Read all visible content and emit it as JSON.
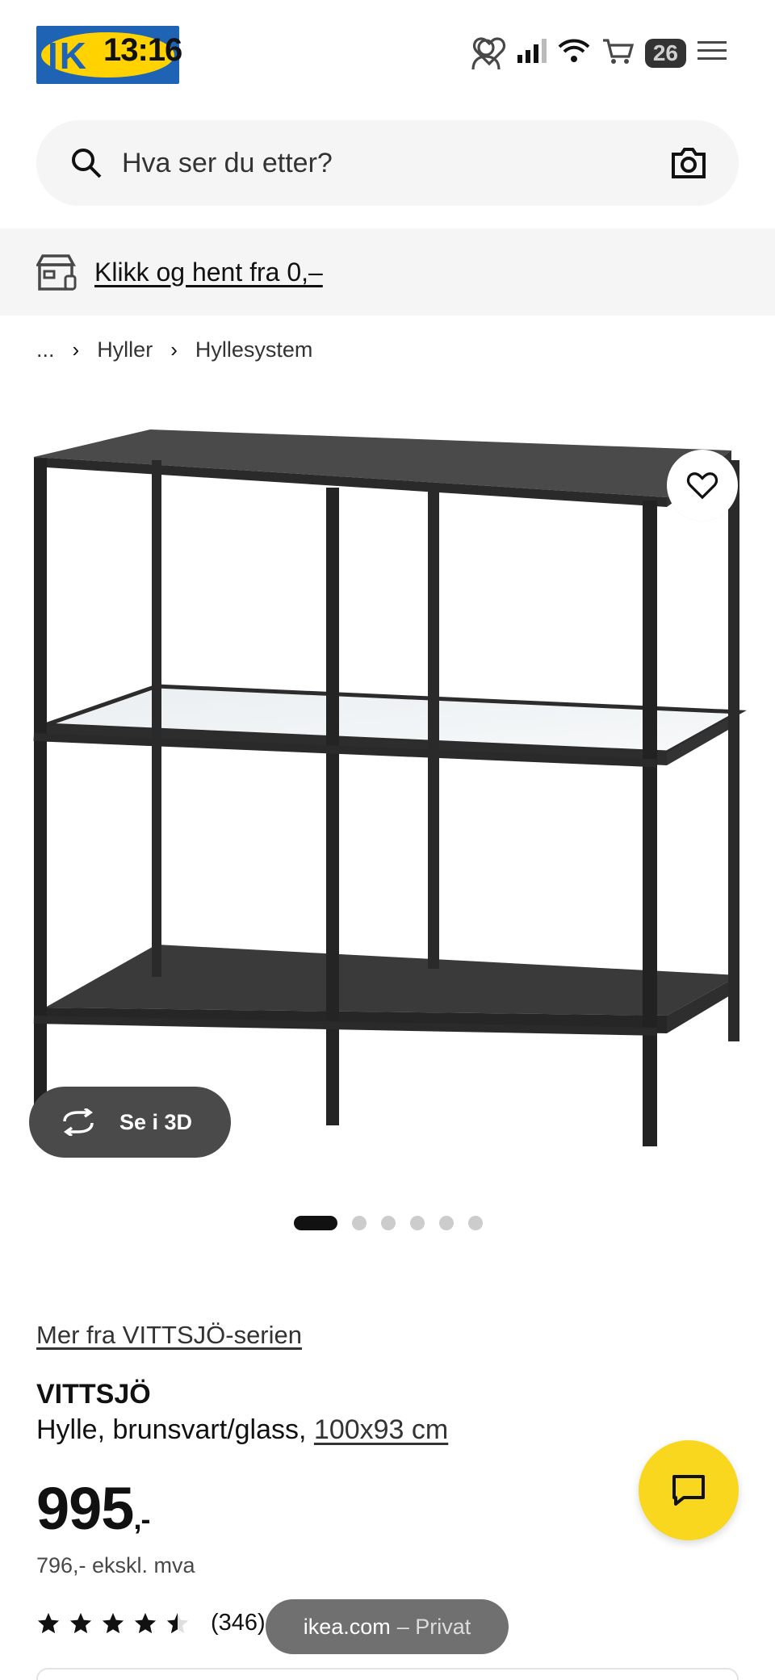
{
  "status_bar": {
    "time": "13:16",
    "battery": "26"
  },
  "header": {
    "logo_text": "IK",
    "icons": [
      "user-icon",
      "heart-icon",
      "cart-icon",
      "menu-icon"
    ]
  },
  "search": {
    "placeholder": "Hva ser du etter?"
  },
  "banner": {
    "text": "Klikk og hent fra 0,–"
  },
  "breadcrumb": {
    "ellipsis": "...",
    "items": [
      "Hyller",
      "Hyllesystem"
    ]
  },
  "gallery": {
    "view_3d_label": "Se i 3D",
    "image_count": 6,
    "active_index": 0
  },
  "product": {
    "series_link": "Mer fra VITTSJÖ-serien",
    "name": "VITTSJÖ",
    "description": "Hylle, brunsvart/glass, ",
    "size_link": "100x93 cm",
    "price_main": "995",
    "price_suffix": ",-",
    "price_ex_vat": "796,- ekskl. mva",
    "rating_value": 4.5,
    "rating_count": "(346)"
  },
  "browser": {
    "domain": "ikea.com",
    "mode": " – Privat"
  },
  "colors": {
    "ikea_blue": "#1f63b5",
    "ikea_yellow": "#ffd200",
    "chat_yellow": "#f8d71e",
    "light_gray": "#f5f5f5"
  }
}
